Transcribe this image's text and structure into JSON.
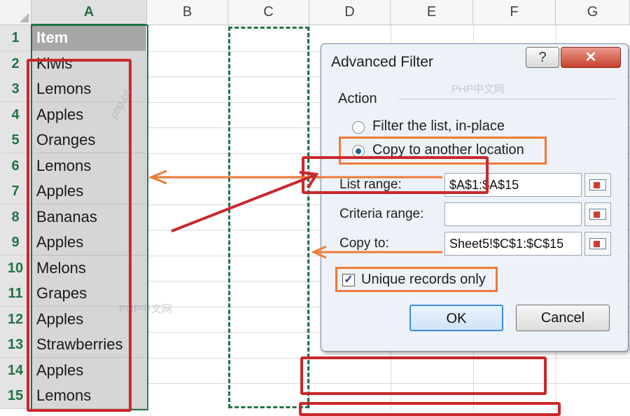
{
  "sheet": {
    "columns": [
      "A",
      "B",
      "C",
      "D",
      "E",
      "F",
      "G"
    ],
    "rows": [
      "1",
      "2",
      "3",
      "4",
      "5",
      "6",
      "7",
      "8",
      "9",
      "10",
      "11",
      "12",
      "13",
      "14",
      "15"
    ],
    "column_a": [
      "Item",
      "Kiwis",
      "Lemons",
      "Apples",
      "Oranges",
      "Lemons",
      "Apples",
      "Bananas",
      "Apples",
      "Melons",
      "Grapes",
      "Apples",
      "Strawberries",
      "Apples",
      "Lemons"
    ]
  },
  "dialog": {
    "title": "Advanced Filter",
    "help_label": "?",
    "close_label": "✕",
    "action_label": "Action",
    "option_filter_in_place": "Filter the list, in-place",
    "option_copy_location": "Copy to another location",
    "selected_option": "copy",
    "list_range_label": "List range:",
    "list_range_value": "$A$1:$A$15",
    "criteria_range_label": "Criteria range:",
    "criteria_range_value": "",
    "copy_to_label": "Copy to:",
    "copy_to_value": "Sheet5!$C$1:$C$15",
    "unique_label": "Unique records only",
    "unique_checked": "✓",
    "ok_label": "OK",
    "cancel_label": "Cancel"
  },
  "watermarks": [
    "PHP中文网",
    "php.cn",
    "PHP中文网"
  ],
  "colors": {
    "excel_green": "#217346",
    "annotation_red": "#c8282c",
    "annotation_orange": "#ef7a39",
    "dialog_bg": "#edf2f8"
  }
}
